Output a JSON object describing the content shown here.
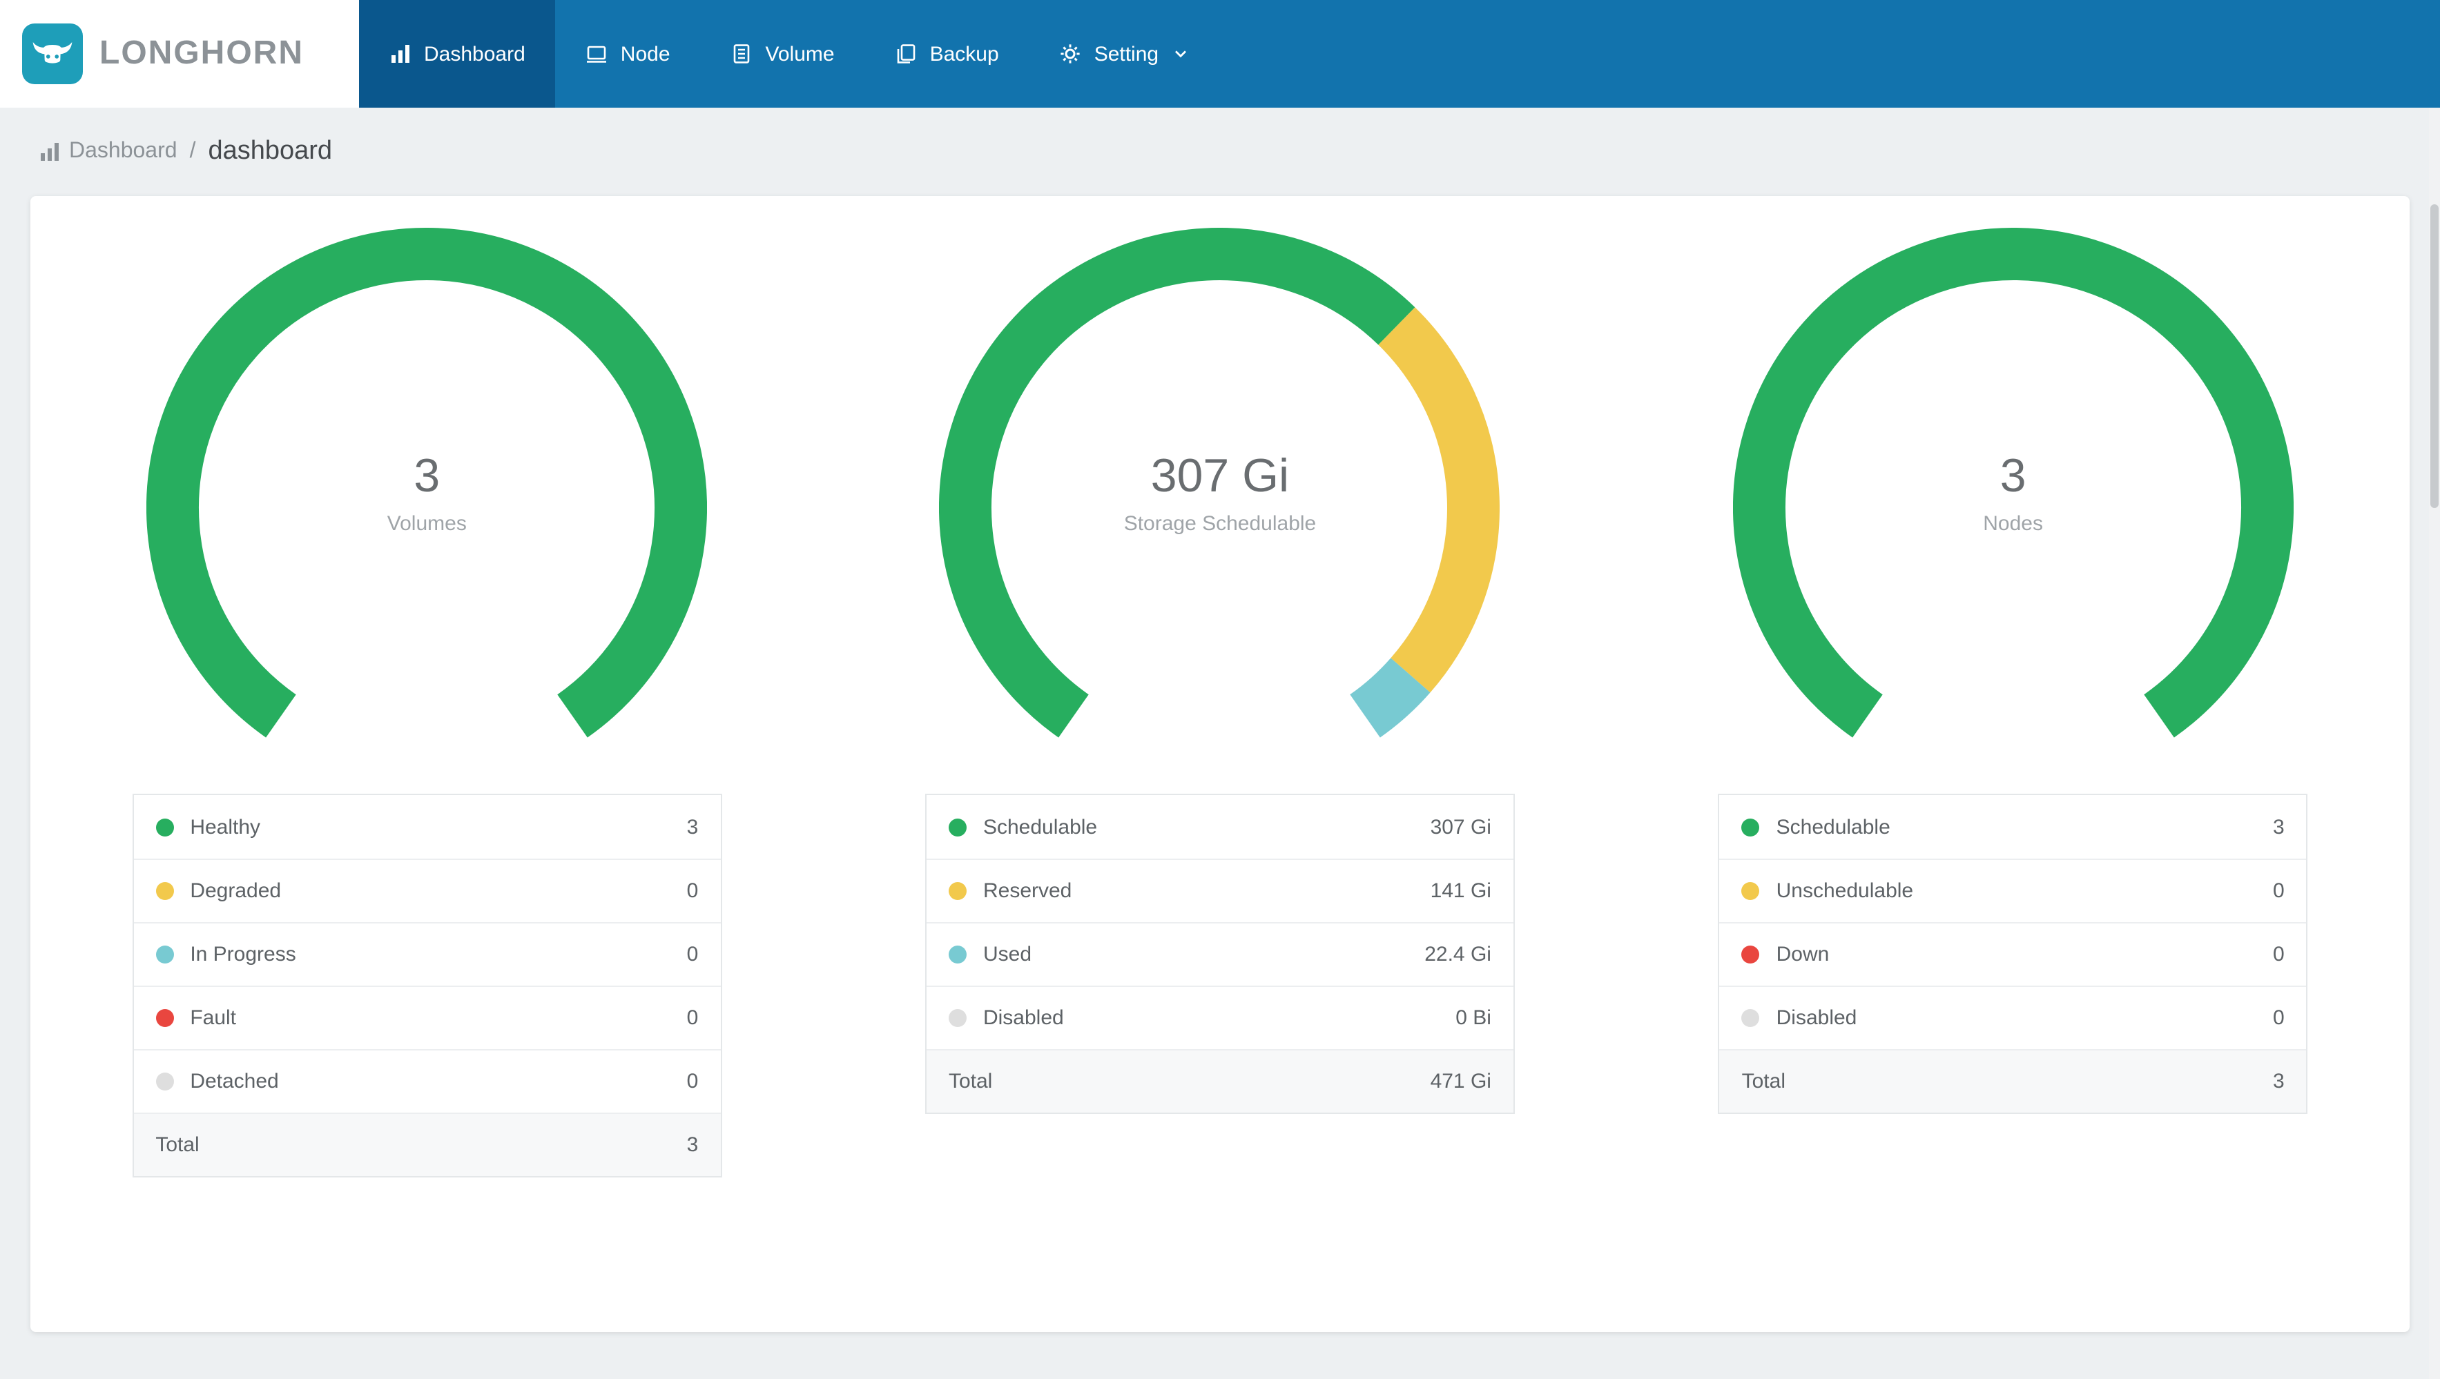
{
  "brand": {
    "name": "LONGHORN"
  },
  "nav": {
    "items": [
      {
        "label": "Dashboard",
        "icon": "bar-chart-icon",
        "active": true,
        "has_dropdown": false
      },
      {
        "label": "Node",
        "icon": "node-icon",
        "active": false,
        "has_dropdown": false
      },
      {
        "label": "Volume",
        "icon": "volume-icon",
        "active": false,
        "has_dropdown": false
      },
      {
        "label": "Backup",
        "icon": "backup-icon",
        "active": false,
        "has_dropdown": false
      },
      {
        "label": "Setting",
        "icon": "gear-icon",
        "active": false,
        "has_dropdown": true
      }
    ]
  },
  "breadcrumb": {
    "section": "Dashboard",
    "separator": "/",
    "page": "dashboard"
  },
  "colors": {
    "navbar": "#1273AD",
    "navbar_active": "#0A578D",
    "logo_teal": "#1E9EB9",
    "green": "#27AE5F",
    "yellow": "#F2C94C",
    "teal": "#78CAD2",
    "red": "#E9463F",
    "gray": "#DEDEDE"
  },
  "chart_data": [
    {
      "type": "donut-gauge",
      "title": "Volumes",
      "center_value": "3",
      "center_label": "Volumes",
      "gauge": {
        "start_angle": 215,
        "sweep_angle": 290
      },
      "segments": [
        {
          "label": "Healthy",
          "value": 3,
          "display": "3",
          "color": "green"
        },
        {
          "label": "Degraded",
          "value": 0,
          "display": "0",
          "color": "yellow"
        },
        {
          "label": "In Progress",
          "value": 0,
          "display": "0",
          "color": "teal"
        },
        {
          "label": "Fault",
          "value": 0,
          "display": "0",
          "color": "red"
        },
        {
          "label": "Detached",
          "value": 0,
          "display": "0",
          "color": "gray"
        }
      ],
      "total": {
        "label": "Total",
        "display": "3"
      }
    },
    {
      "type": "donut-gauge",
      "title": "Storage Schedulable",
      "center_value": "307 Gi",
      "center_label": "Storage Schedulable",
      "gauge": {
        "start_angle": 215,
        "sweep_angle": 290
      },
      "segments": [
        {
          "label": "Schedulable",
          "value": 307,
          "display": "307 Gi",
          "color": "green"
        },
        {
          "label": "Reserved",
          "value": 141,
          "display": "141 Gi",
          "color": "yellow"
        },
        {
          "label": "Used",
          "value": 22.4,
          "display": "22.4 Gi",
          "color": "teal"
        },
        {
          "label": "Disabled",
          "value": 0,
          "display": "0 Bi",
          "color": "gray"
        }
      ],
      "total": {
        "label": "Total",
        "display": "471 Gi"
      }
    },
    {
      "type": "donut-gauge",
      "title": "Nodes",
      "center_value": "3",
      "center_label": "Nodes",
      "gauge": {
        "start_angle": 215,
        "sweep_angle": 290
      },
      "segments": [
        {
          "label": "Schedulable",
          "value": 3,
          "display": "3",
          "color": "green"
        },
        {
          "label": "Unschedulable",
          "value": 0,
          "display": "0",
          "color": "yellow"
        },
        {
          "label": "Down",
          "value": 0,
          "display": "0",
          "color": "red"
        },
        {
          "label": "Disabled",
          "value": 0,
          "display": "0",
          "color": "gray"
        }
      ],
      "total": {
        "label": "Total",
        "display": "3"
      }
    }
  ]
}
